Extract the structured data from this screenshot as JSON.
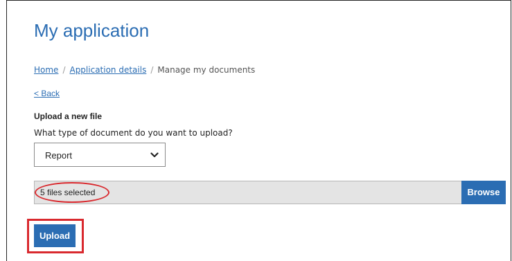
{
  "header": {
    "title": "My application"
  },
  "breadcrumb": {
    "items": [
      {
        "label": "Home"
      },
      {
        "label": "Application details"
      },
      {
        "label": "Manage my documents"
      }
    ],
    "separator": "/"
  },
  "back_link": "< Back",
  "upload_form": {
    "section_title": "Upload a new file",
    "question": "What type of document do you want to upload?",
    "document_type": {
      "selected": "Report"
    },
    "file_picker": {
      "status_text": "5 files selected",
      "browse_label": "Browse"
    },
    "submit_label": "Upload"
  },
  "annotations": {
    "highlight_color": "#d9292e"
  },
  "colors": {
    "accent": "#2b6db3",
    "file_field_bg": "#e4e4e4"
  },
  "icons": {
    "select_chevron": "chevron-down-icon"
  }
}
